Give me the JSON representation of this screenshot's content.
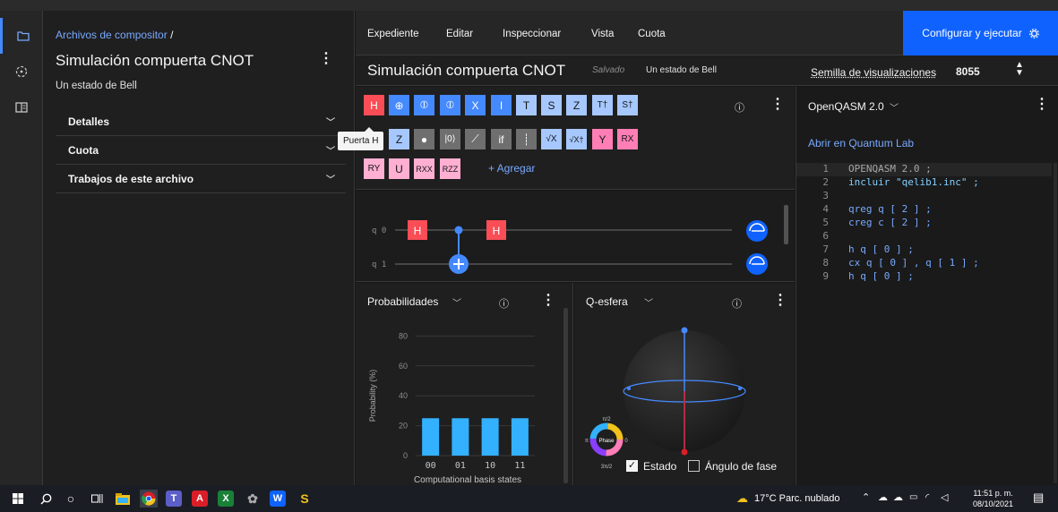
{
  "rail": {
    "items": [
      {
        "icon": "folder-icon"
      },
      {
        "icon": "jobs-icon"
      },
      {
        "icon": "docs-panel-icon"
      }
    ]
  },
  "left_panel": {
    "breadcrumb": "Archivos de compositor",
    "breadcrumb_sep": "/",
    "title": "Simulación compuerta CNOT",
    "subtitle": "Un estado de Bell",
    "sections": [
      "Detalles",
      "Cuota",
      "Trabajos de este archivo"
    ]
  },
  "menu": {
    "items": [
      "Expediente",
      "Editar",
      "Inspeccionar",
      "Vista",
      "Cuota"
    ],
    "run_label": "Configurar y ejecutar"
  },
  "circuit": {
    "title": "Simulación compuerta CNOT",
    "saved": "Salvado",
    "subtitle": "Un estado de Bell",
    "seed_label": "Semilla de visualizaciones",
    "seed_value": "8055"
  },
  "palette": {
    "row1": [
      "H",
      "⊕",
      "⦶",
      "⦶",
      "X",
      "I",
      "T",
      "S",
      "Z",
      "T†",
      "S†"
    ],
    "row2": [
      "Z",
      "●",
      "|0⟩",
      "⟋",
      "if",
      "┊",
      "√X",
      "√X†",
      "Y",
      "RX"
    ],
    "row3": [
      "RY",
      "U",
      "RXX",
      "RZZ"
    ],
    "add_label": "+ Agregar",
    "tooltip": "Puerta H"
  },
  "composer": {
    "qubits": [
      "q 0",
      "q 1"
    ],
    "gates": [
      "H",
      "H"
    ]
  },
  "probabilities": {
    "title": "Probabilidades",
    "chart_data": {
      "type": "bar",
      "categories": [
        "00",
        "01",
        "10",
        "11"
      ],
      "values": [
        25,
        25,
        25,
        25
      ],
      "ylabel": "Probability (%)",
      "xlabel": "Computational basis states",
      "yticks": [
        "0",
        "20",
        "40",
        "60",
        "80"
      ],
      "ylim": [
        0,
        100
      ],
      "color": "#33b1ff"
    }
  },
  "qsphere": {
    "title": "Q-esfera",
    "state_label": "Estado",
    "state_checked": true,
    "phase_label": "Ángulo de fase",
    "phase_checked": false,
    "wheel": {
      "center": "Phase",
      "top": "π/2",
      "left": "π",
      "right": "0",
      "bottom": "3π/2"
    }
  },
  "code": {
    "language": "OpenQASM 2.0",
    "open_lab": "Abrir en Quantum Lab",
    "lines": [
      {
        "n": "1",
        "text": "OPENQASM 2.0 ;"
      },
      {
        "n": "2",
        "text": "incluir \"qelib1.inc\" ;"
      },
      {
        "n": "3",
        "text": ""
      },
      {
        "n": "4",
        "text": "qreg q [ 2 ] ;"
      },
      {
        "n": "5",
        "text": "creg c [ 2 ] ;"
      },
      {
        "n": "6",
        "text": ""
      },
      {
        "n": "7",
        "text": "h q [ 0 ] ;"
      },
      {
        "n": "8",
        "text": "cx q [ 0 ] , q [ 1 ] ;"
      },
      {
        "n": "9",
        "text": "h q [ 0 ] ;"
      }
    ]
  },
  "taskbar": {
    "weather": "17°C  Parc. nublado",
    "time": "11:51 p. m.",
    "date": "08/10/2021"
  }
}
